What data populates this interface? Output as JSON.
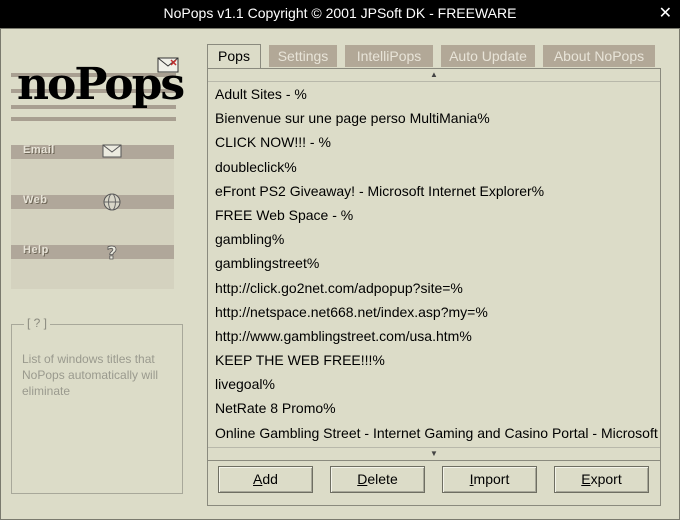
{
  "window": {
    "title": "NoPops v1.1 Copyright © 2001 JPSoft DK - FREEWARE",
    "close_glyph": "✕"
  },
  "logo": {
    "text": "noPops"
  },
  "sidebar": {
    "items": [
      {
        "label": "Email",
        "icon": "envelope-icon"
      },
      {
        "label": "Web",
        "icon": "globe-icon"
      },
      {
        "label": "Help",
        "icon": "question-icon"
      }
    ]
  },
  "help_box": {
    "legend": "[ ? ]",
    "text": "List of windows titles that NoPops automatically will eliminate"
  },
  "tabs": [
    {
      "label": "Pops",
      "active": true
    },
    {
      "label": "Settings",
      "active": false
    },
    {
      "label": "IntelliPops",
      "active": false
    },
    {
      "label": "Auto Update",
      "active": false
    },
    {
      "label": "About NoPops",
      "active": false
    }
  ],
  "list": {
    "scroll_up_glyph": "▲",
    "scroll_down_glyph": "▼",
    "items": [
      "Adult Sites - %",
      "Bienvenue sur une page perso MultiMania%",
      "CLICK NOW!!! - %",
      "doubleclick%",
      "eFront PS2 Giveaway! - Microsoft Internet Explorer%",
      "FREE Web Space - %",
      "gambling%",
      "gamblingstreet%",
      "http://click.go2net.com/adpopup?site=%",
      "http://netspace.net668.net/index.asp?my=%",
      "http://www.gamblingstreet.com/usa.htm%",
      "KEEP THE WEB FREE!!!%",
      "livegoal%",
      "NetRate 8 Promo%",
      "Online Gambling Street - Internet Gaming and Casino Portal - Microsoft Internet Explorer%"
    ]
  },
  "buttons": {
    "add": {
      "first": "A",
      "rest": "dd"
    },
    "delete": {
      "first": "D",
      "rest": "elete"
    },
    "import": {
      "first": "I",
      "rest": "mport"
    },
    "export": {
      "first": "E",
      "rest": "xport"
    }
  },
  "colors": {
    "window_bg": "#dcdcc8",
    "tab_inactive": "#b2a897",
    "stripe": "#a89f91"
  }
}
